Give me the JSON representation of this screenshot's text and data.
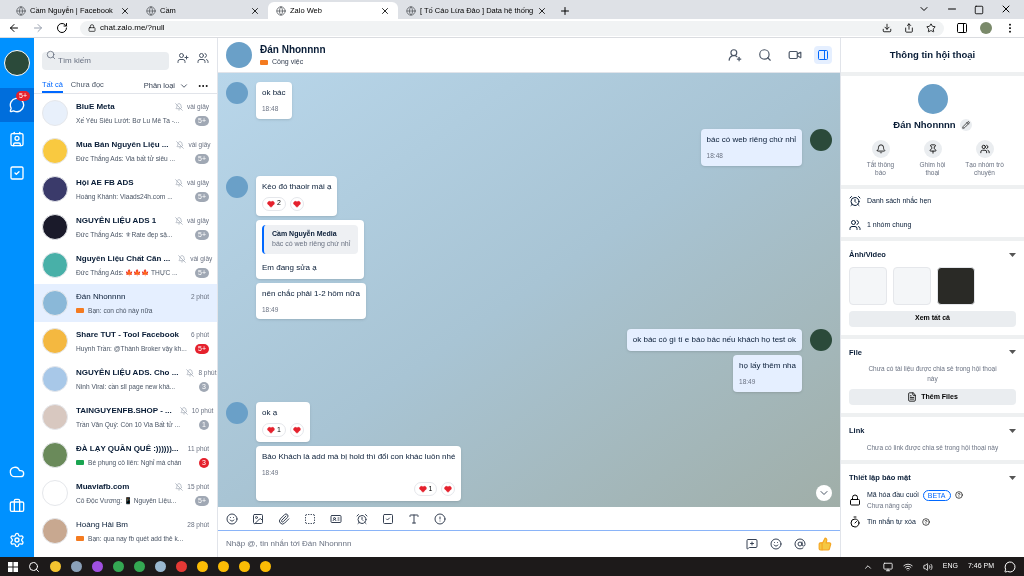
{
  "browser": {
    "tabs": [
      {
        "title": "Cầm Nguyễn | Facebook",
        "selected": false
      },
      {
        "title": "Cầm",
        "selected": false
      },
      {
        "title": "Zalo Web",
        "selected": true
      },
      {
        "title": "[ Tố Cáo Lừa Đảo ] Data hệ thống",
        "selected": false
      }
    ],
    "url": "chat.zalo.me/?null"
  },
  "rail": {
    "chat_badge": "5+"
  },
  "list": {
    "search": {
      "placeholder": "Tìm kiếm"
    },
    "filters": [
      {
        "label": "Tất cả",
        "selected": true
      },
      {
        "label": "Chưa đọc",
        "selected": false
      }
    ],
    "sort_label": "Phân loại",
    "conversations": [
      {
        "name": "BluE Meta",
        "time": "vài giây",
        "preview": "Xế Yêu Siêu Lướt: Bơ Lu Mê Ta -...",
        "muted": true,
        "unread": true,
        "selected": false,
        "badge": {
          "text": "5+",
          "color": "#a0a8b4"
        }
      },
      {
        "name": "Mua Bán Nguyên Liệu ...",
        "time": "vài giây",
        "preview": "Đức Thắng Ads: Via bất tử siêu ...",
        "muted": true,
        "unread": true,
        "selected": false,
        "badge": {
          "text": "5+",
          "color": "#a0a8b4"
        }
      },
      {
        "name": "Hội AE FB ADS",
        "time": "vài giây",
        "preview": "Hoàng Khánh: Viaads24h.com ...",
        "muted": true,
        "unread": true,
        "selected": false,
        "badge": {
          "text": "5+",
          "color": "#a0a8b4"
        }
      },
      {
        "name": "NGUYÊN LIỆU ADS 1",
        "time": "vài giây",
        "preview": "Đức Thắng Ads: ⚜Rate đẹp sậ...",
        "muted": true,
        "unread": true,
        "selected": false,
        "badge": {
          "text": "5+",
          "color": "#a0a8b4"
        }
      },
      {
        "name": "Nguyên Liệu Chất Căn ...",
        "time": "vài giây",
        "preview": "Đức Thắng Ads: 🍁🍁🍁 THỰC ...",
        "muted": true,
        "unread": true,
        "selected": false,
        "badge": {
          "text": "5+",
          "color": "#a0a8b4"
        }
      },
      {
        "name": "Đán Nhonnnn",
        "time": "2 phút",
        "preview": "Bạn: con chó này nữa",
        "muted": false,
        "unread": false,
        "selected": true,
        "tag": {
          "color": "#f47b20"
        }
      },
      {
        "name": "Share TUT - Tool Facebook",
        "time": "6 phút",
        "preview": "Huynh Trần: @Thành Broker vậy kh...",
        "muted": false,
        "unread": true,
        "selected": false,
        "badge": {
          "text": "5+",
          "color": "#e5212d"
        }
      },
      {
        "name": "NGUYÊN LIỆU ADS. Cho ...",
        "time": "8 phút",
        "preview": "Ninh Viral: cần sll page new khá...",
        "muted": true,
        "unread": true,
        "selected": false,
        "badge": {
          "text": "3",
          "color": "#a0a8b4"
        }
      },
      {
        "name": "TAINGUYENFB.SHOP - ...",
        "time": "10 phút",
        "preview": "Trần Văn Quý: Còn 10 Via Bất tử ...",
        "muted": true,
        "unread": true,
        "selected": false,
        "badge": {
          "text": "1",
          "color": "#a0a8b4"
        }
      },
      {
        "name": "ĐÀ LẠY QUẦN QUÊ :))))))...",
        "time": "11 phút",
        "preview": "Bé phụng cô liên: Nghỉ mà chán",
        "muted": false,
        "unread": true,
        "selected": false,
        "tag": {
          "color": "#1aa551"
        },
        "badge": {
          "text": "3",
          "color": "#e5212d"
        }
      },
      {
        "name": "Muaviafb.com",
        "time": "15 phút",
        "preview": "Cô Độc Vương: 📱 Nguyên Liệu...",
        "muted": true,
        "unread": true,
        "selected": false,
        "badge": {
          "text": "5+",
          "color": "#a0a8b4"
        }
      },
      {
        "name": "Hoàng Hải Bm",
        "time": "28 phút",
        "preview": "Bạn: qua nay fb quét add thẻ k...",
        "muted": false,
        "unread": false,
        "selected": false,
        "tag": {
          "color": "#f47b20"
        }
      }
    ]
  },
  "chat": {
    "name": "Đán Nhonnnn",
    "label": {
      "text": "Công việc",
      "color": "#f47b20"
    },
    "messages": [
      {
        "kind": "incoming",
        "avatar": true,
        "text": "ok bác",
        "time": "18:48"
      },
      {
        "kind": "outgoing",
        "avatar": true,
        "text": "bác có web riêng chứ nhỉ",
        "time": "18:48"
      },
      {
        "kind": "incoming",
        "avatar": true,
        "text": "Kèo đó thaoir mái ạ",
        "reaction_count": "2"
      },
      {
        "kind": "incoming",
        "avatar": false,
        "quote": {
          "author": "Cầm Nguyễn Media",
          "text": "bác có web riêng chứ nhỉ"
        },
        "text": "Em đang sửa ạ"
      },
      {
        "kind": "incoming",
        "avatar": false,
        "text": "nên chắc phải 1-2 hôm nữa",
        "time": "18:49"
      },
      {
        "kind": "outgoing",
        "avatar": true,
        "text": "ok bác có gì tí e báo bác nếu khách họ test ok"
      },
      {
        "kind": "outgoing",
        "avatar": false,
        "text": "họ lấy thêm nha",
        "time": "18:49"
      },
      {
        "kind": "incoming",
        "avatar": true,
        "text": "ok ạ",
        "reaction_count": "1"
      },
      {
        "kind": "incoming",
        "avatar": false,
        "text": "Bảo Khách là add mà bị hold thì đổi con khác luôn nhé",
        "time": "18:49",
        "reaction_count": "1"
      }
    ],
    "input": {
      "placeholder": "Nhập @, tin nhắn tới Đán Nhonnnn"
    }
  },
  "info": {
    "title": "Thông tin hội thoại",
    "name": "Đán Nhonnnn",
    "actions": [
      "Tắt thông báo",
      "Ghim hội thoại",
      "Tạo nhóm trò chuyện"
    ],
    "rows": [
      "Danh sách nhắc hẹn",
      "1 nhóm chung"
    ],
    "media": {
      "title": "Ảnh/Video",
      "button": "Xem tất cả"
    },
    "file": {
      "title": "File",
      "empty": "Chưa có tài liệu được chia sẻ trong hội thoại này",
      "button": "Thêm Files"
    },
    "link": {
      "title": "Link",
      "empty": "Chưa có link được chia sẻ trong hội thoại này"
    },
    "security": {
      "title": "Thiết lập bảo mật",
      "e2e": "Mã hóa đầu cuối",
      "beta": "BETA",
      "e2e_status": "Chưa nâng cấp",
      "self_delete": "Tin nhắn tự xóa"
    }
  },
  "taskbar": {
    "language": "ENG",
    "time": "7:46 PM"
  }
}
